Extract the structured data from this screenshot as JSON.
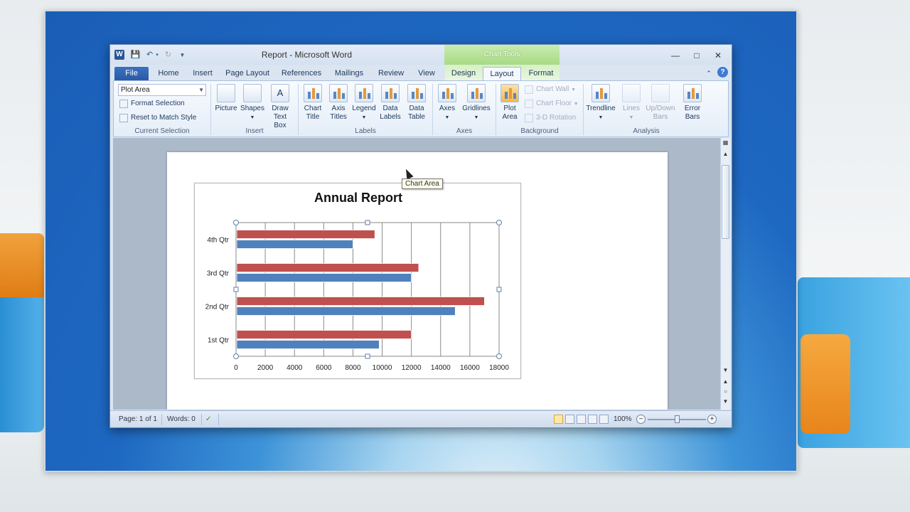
{
  "window": {
    "title": "Report  -  Microsoft Word",
    "contextual_tab_group": "Chart Tools"
  },
  "tabs": [
    "File",
    "Home",
    "Insert",
    "Page Layout",
    "References",
    "Mailings",
    "Review",
    "View",
    "Design",
    "Layout",
    "Format"
  ],
  "active_tab": "Layout",
  "ribbon": {
    "current_selection": {
      "dropdown_value": "Plot Area",
      "format_selection": "Format Selection",
      "reset_style": "Reset to Match Style",
      "label": "Current Selection"
    },
    "insert": {
      "picture": "Picture",
      "shapes": "Shapes",
      "draw_text_box": "Draw Text Box",
      "label": "Insert"
    },
    "labels": {
      "chart_title": "Chart Title",
      "axis_titles": "Axis Titles",
      "legend": "Legend",
      "data_labels": "Data Labels",
      "data_table": "Data Table",
      "label": "Labels"
    },
    "axes": {
      "axes": "Axes",
      "gridlines": "Gridlines",
      "label": "Axes"
    },
    "background": {
      "plot_area": "Plot Area",
      "chart_wall": "Chart Wall",
      "chart_floor": "Chart Floor",
      "rotation": "3-D Rotation",
      "label": "Background"
    },
    "analysis": {
      "trendline": "Trendline",
      "lines": "Lines",
      "updown_bars": "Up/Down Bars",
      "error_bars": "Error Bars",
      "label": "Analysis"
    }
  },
  "tooltip": "Chart Area",
  "status": {
    "page": "Page: 1 of 1",
    "words": "Words: 0",
    "zoom": "100%"
  },
  "colors": {
    "series_red": "#c0504d",
    "series_blue": "#4f81bd",
    "accent_green": "#a7da83",
    "file_tab": "#2a5aa6"
  },
  "chart_data": {
    "type": "bar",
    "orientation": "horizontal",
    "title": "Annual Report",
    "categories": [
      "1st Qtr",
      "2nd Qtr",
      "3rd Qtr",
      "4th Qtr"
    ],
    "series": [
      {
        "values": [
          9800,
          15000,
          12000,
          8000
        ]
      },
      {
        "values": [
          12000,
          17000,
          12500,
          9500
        ]
      }
    ],
    "xlim": [
      0,
      18000
    ],
    "xticks": [
      "0",
      "2000",
      "4000",
      "6000",
      "8000",
      "10000",
      "12000",
      "14000",
      "16000",
      "18000"
    ],
    "grid": true,
    "legend": "none"
  }
}
